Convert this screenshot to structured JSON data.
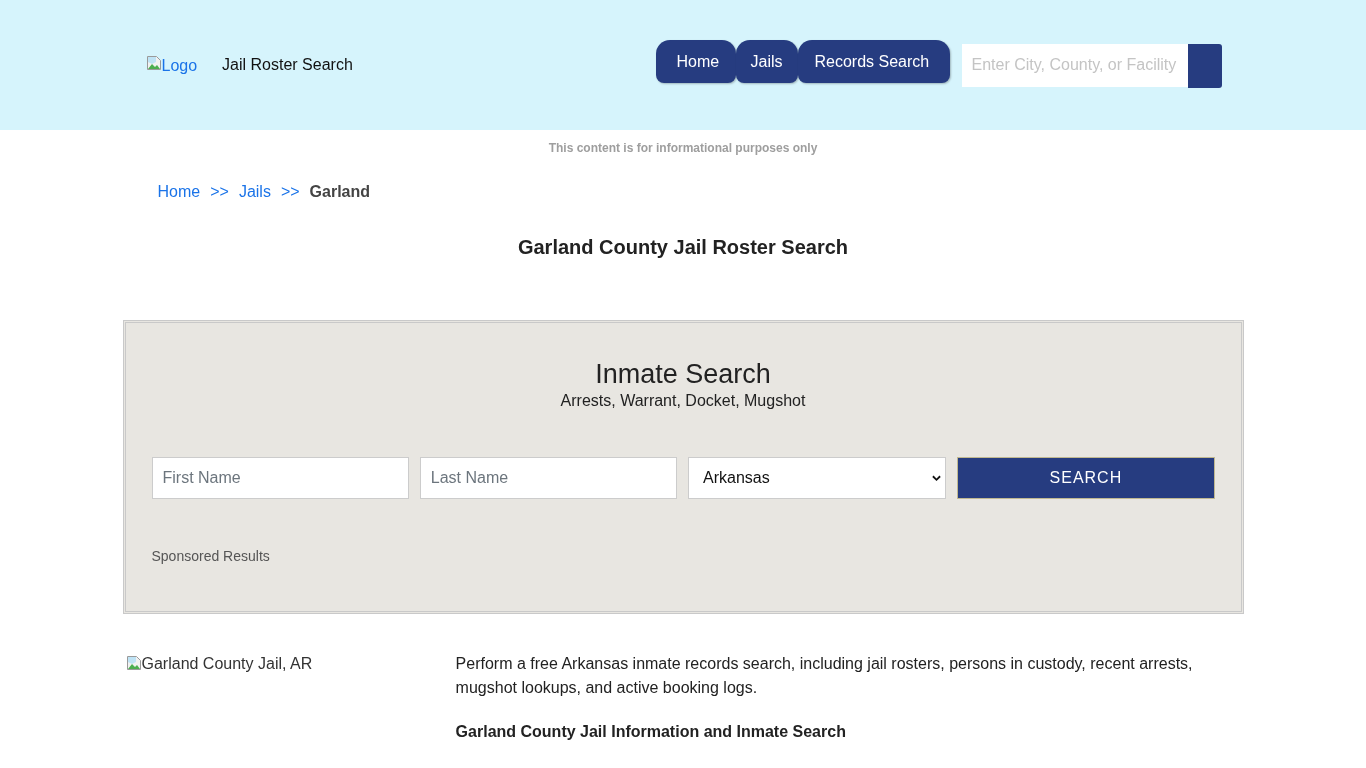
{
  "header": {
    "logo": {
      "alt": "Logo"
    },
    "site_name": "Jail Roster Search",
    "nav": [
      {
        "label": "Home"
      },
      {
        "label": "Jails"
      },
      {
        "label": "Records Search"
      }
    ],
    "search": {
      "placeholder": "Enter City, County, or Facility"
    }
  },
  "disclaimer": "This content is for informational purposes only",
  "breadcrumb": [
    {
      "kind": "link",
      "label": "Home"
    },
    {
      "kind": "separator",
      "label": ">>"
    },
    {
      "kind": "link",
      "label": "Jails"
    },
    {
      "kind": "separator",
      "label": ">>"
    },
    {
      "kind": "current",
      "label": "Garland"
    }
  ],
  "page_title": "Garland County Jail Roster Search",
  "inmate_search": {
    "title": "Inmate Search",
    "subtitle": "Arrests, Warrant, Docket, Mugshot",
    "fields": [
      {
        "placeholder": "First Name"
      },
      {
        "placeholder": "Last Name"
      }
    ],
    "state_select": {
      "value": "Arkansas"
    },
    "button": "SEARCH",
    "sponsored": "Sponsored Results"
  },
  "facility_image": {
    "alt": "Garland County Jail, AR"
  },
  "intro": "Perform a free Arkansas inmate records search, including jail rosters, persons in custody, recent arrests, mugshot lookups, and active booking logs.",
  "section_heading": "Garland County Jail Information and Inmate Search"
}
